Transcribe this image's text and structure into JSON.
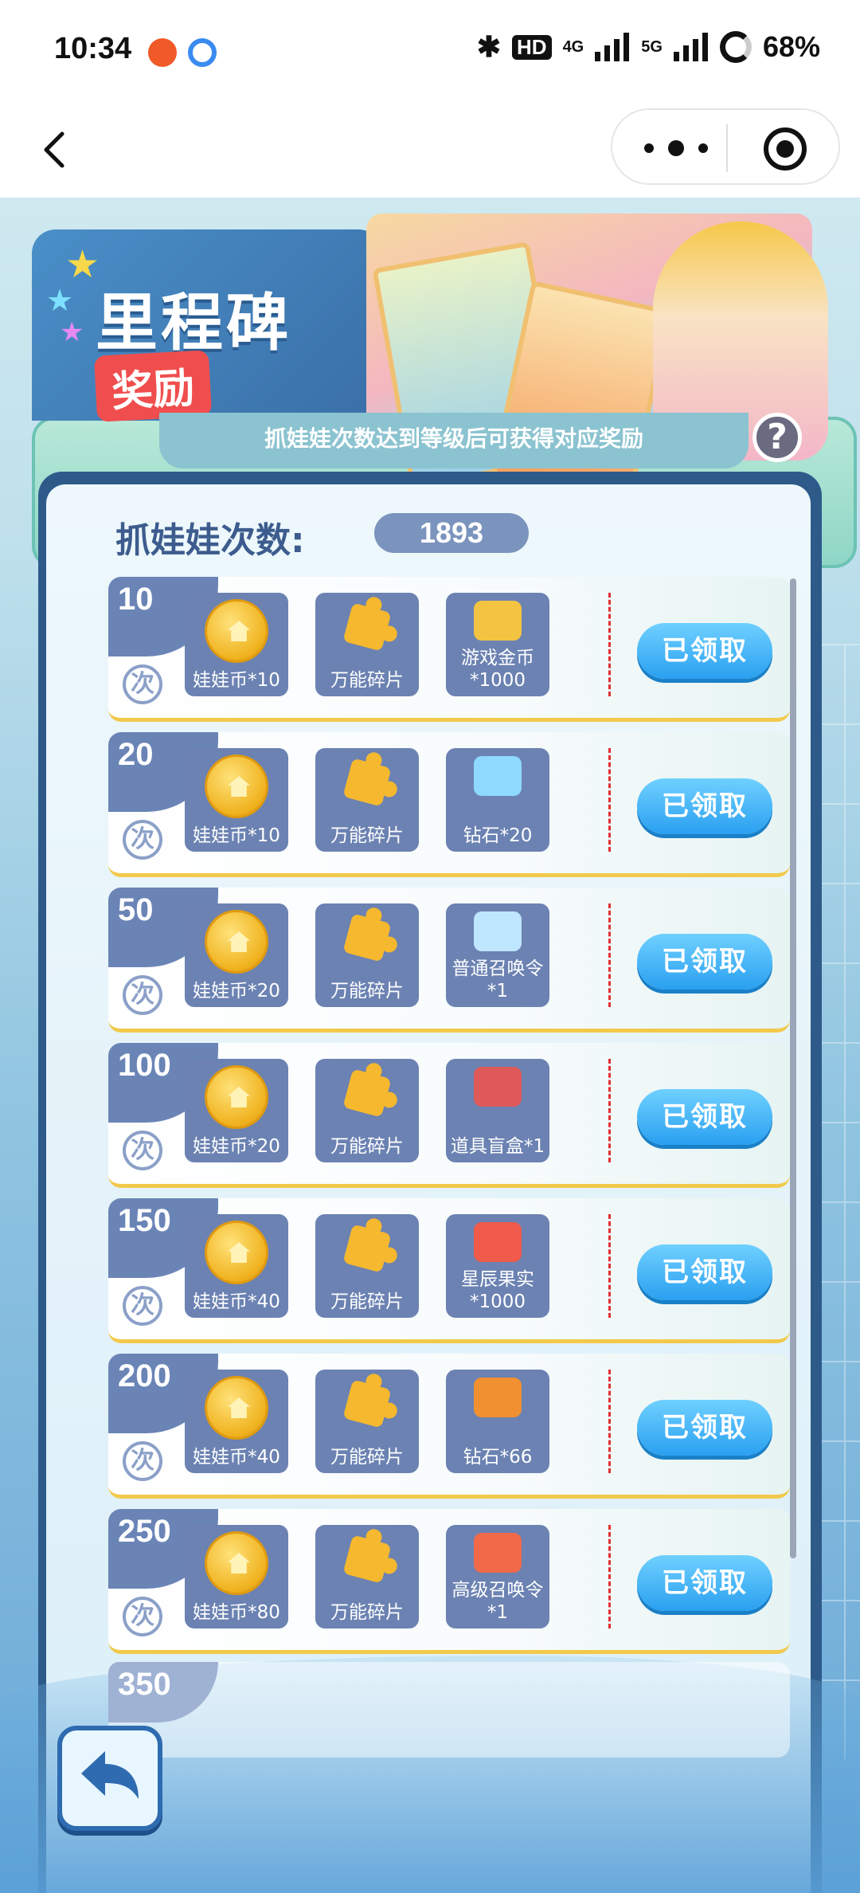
{
  "status_bar": {
    "time": "10:34",
    "hd": "HD",
    "network": "4G",
    "network2": "5G",
    "battery": "68%"
  },
  "nav": {
    "back_icon": "chevron-left-icon",
    "more_icon": "more-dots-icon",
    "close_icon": "target-close-icon"
  },
  "banner": {
    "title_main": "里程碑",
    "title_sub": "奖励",
    "description": "抓娃娃次数达到等级后可获得对应奖励",
    "help_label": "?"
  },
  "counter": {
    "label": "抓娃娃次数:",
    "value": "1893"
  },
  "milestones": [
    {
      "tier": "10",
      "unit": "次",
      "rewards": [
        "娃娃币*10",
        "万能碎片",
        "游戏金币\n*1000"
      ],
      "third_icon": "gold-coins-icon",
      "button": "已领取"
    },
    {
      "tier": "20",
      "unit": "次",
      "rewards": [
        "娃娃币*10",
        "万能碎片",
        "钻石*20"
      ],
      "third_icon": "diamond-icon",
      "button": "已领取"
    },
    {
      "tier": "50",
      "unit": "次",
      "rewards": [
        "娃娃币*20",
        "万能碎片",
        "普通召唤令\n*1"
      ],
      "third_icon": "normal-summon-token-icon",
      "button": "已领取"
    },
    {
      "tier": "100",
      "unit": "次",
      "rewards": [
        "娃娃币*20",
        "万能碎片",
        "道具盲盒*1"
      ],
      "third_icon": "blind-box-icon",
      "button": "已领取"
    },
    {
      "tier": "150",
      "unit": "次",
      "rewards": [
        "娃娃币*40",
        "万能碎片",
        "星辰果实\n*1000"
      ],
      "third_icon": "star-fruit-icon",
      "button": "已领取"
    },
    {
      "tier": "200",
      "unit": "次",
      "rewards": [
        "娃娃币*40",
        "万能碎片",
        "钻石*66"
      ],
      "third_icon": "diamond-bag-icon",
      "button": "已领取"
    },
    {
      "tier": "250",
      "unit": "次",
      "rewards": [
        "娃娃币*80",
        "万能碎片",
        "高级召唤令\n*1"
      ],
      "third_icon": "advanced-summon-token-icon",
      "button": "已领取"
    }
  ],
  "partial_tier": "350",
  "colors": {
    "accent": "#2aa0f0",
    "tab": "#6a84b6",
    "gold": "#f2c94c",
    "divider": "#e03030"
  }
}
